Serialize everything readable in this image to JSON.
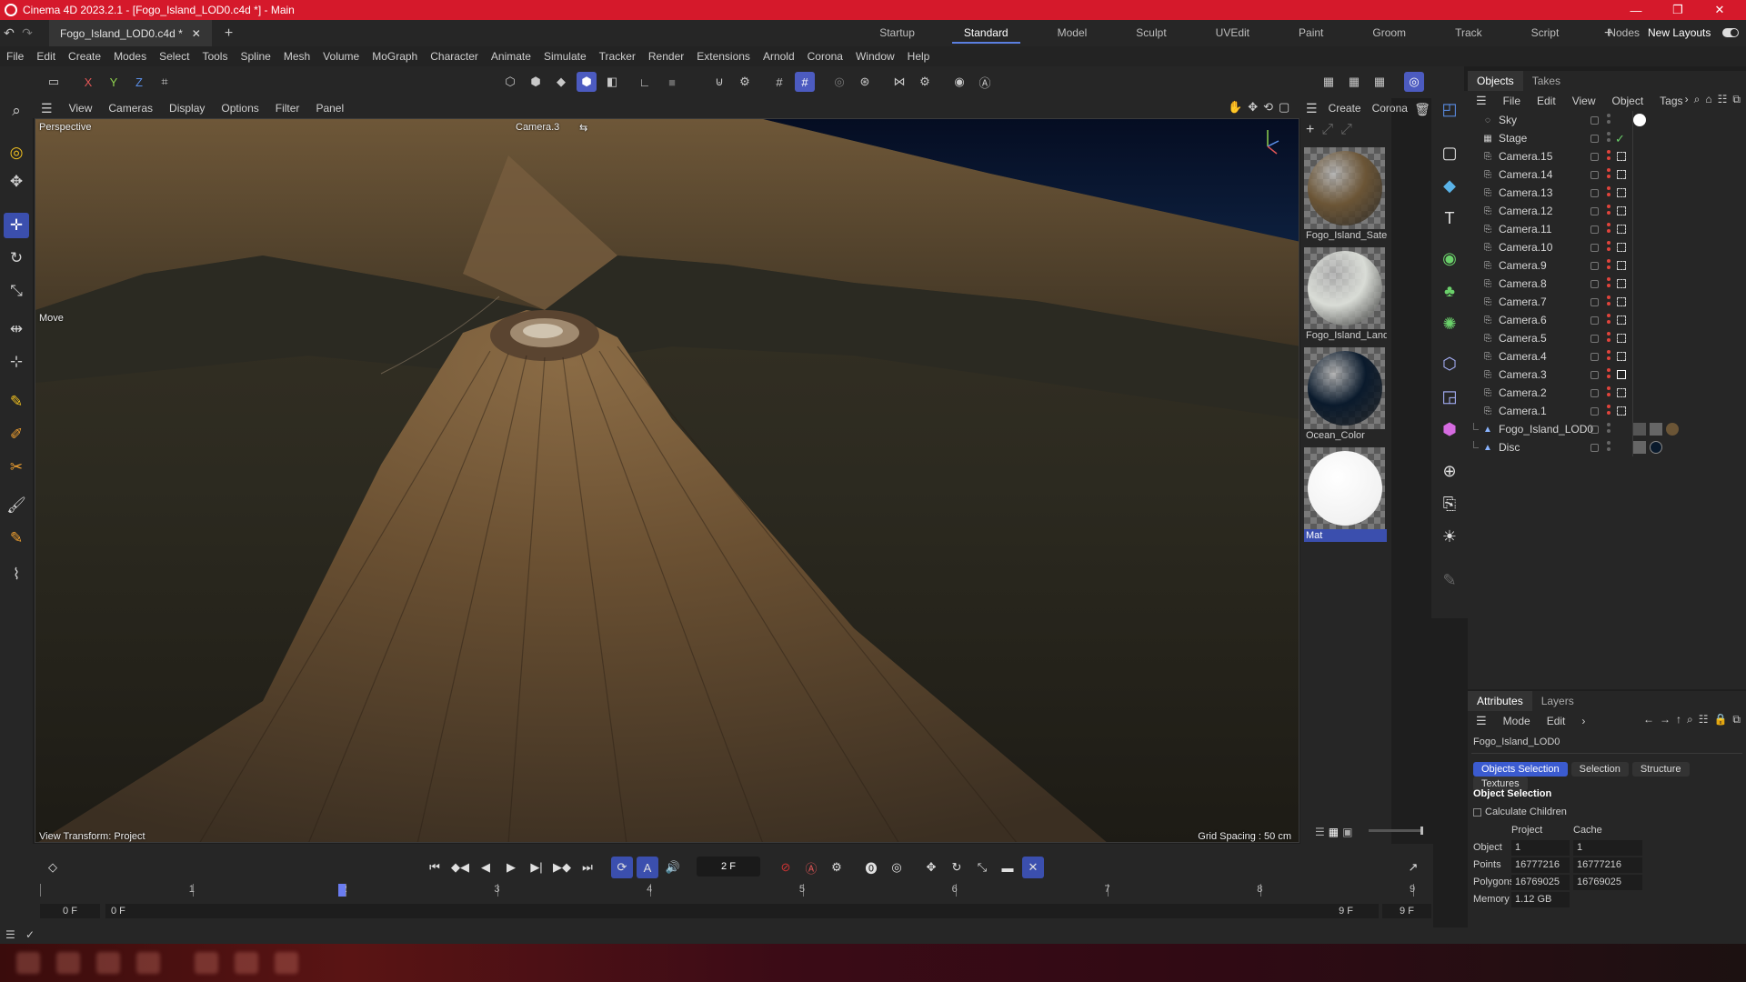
{
  "window": {
    "title": "Cinema 4D 2023.2.1 - [Fogo_Island_LOD0.c4d *] - Main",
    "doc_tab": "Fogo_Island_LOD0.c4d *",
    "controls": [
      "—",
      "❐",
      "✕"
    ]
  },
  "layouts": [
    "Startup",
    "Standard",
    "Model",
    "Sculpt",
    "UVEdit",
    "Paint",
    "Groom",
    "Track",
    "Script",
    "Nodes"
  ],
  "layout_active": "Standard",
  "new_layouts": "New Layouts",
  "menu": [
    "File",
    "Edit",
    "Create",
    "Modes",
    "Select",
    "Tools",
    "Spline",
    "Mesh",
    "Volume",
    "MoGraph",
    "Character",
    "Animate",
    "Simulate",
    "Tracker",
    "Render",
    "Extensions",
    "Arnold",
    "Corona",
    "Window",
    "Help"
  ],
  "axes": {
    "x": "X",
    "y": "Y",
    "z": "Z"
  },
  "viewport": {
    "menu": [
      "View",
      "Cameras",
      "Display",
      "Options",
      "Filter",
      "Panel"
    ],
    "projection": "Perspective",
    "camera": "Camera.3",
    "tool": "Move",
    "transform": "View Transform: Project",
    "grid": "Grid Spacing : 50 cm"
  },
  "materials": {
    "menu": [
      "Create",
      "Corona"
    ],
    "items": [
      {
        "name": "Fogo_Island_Satel",
        "color": "#6b5536"
      },
      {
        "name": "Fogo_Island_Land",
        "color": "#d9dcd6"
      },
      {
        "name": "Ocean_Color",
        "color": "#0a1a2c"
      },
      {
        "name": "Mat",
        "color": "#ffffff"
      }
    ]
  },
  "objects": {
    "tabs": [
      "Objects",
      "Takes"
    ],
    "menu": [
      "File",
      "Edit",
      "View",
      "Object",
      "Tags"
    ],
    "items": [
      {
        "name": "Sky",
        "icon": "sky-icon"
      },
      {
        "name": "Stage",
        "icon": "stage-icon"
      },
      {
        "name": "Camera.15",
        "icon": "camera-icon"
      },
      {
        "name": "Camera.14",
        "icon": "camera-icon"
      },
      {
        "name": "Camera.13",
        "icon": "camera-icon"
      },
      {
        "name": "Camera.12",
        "icon": "camera-icon"
      },
      {
        "name": "Camera.11",
        "icon": "camera-icon"
      },
      {
        "name": "Camera.10",
        "icon": "camera-icon"
      },
      {
        "name": "Camera.9",
        "icon": "camera-icon"
      },
      {
        "name": "Camera.8",
        "icon": "camera-icon"
      },
      {
        "name": "Camera.7",
        "icon": "camera-icon"
      },
      {
        "name": "Camera.6",
        "icon": "camera-icon"
      },
      {
        "name": "Camera.5",
        "icon": "camera-icon"
      },
      {
        "name": "Camera.4",
        "icon": "camera-icon"
      },
      {
        "name": "Camera.3",
        "icon": "camera-icon"
      },
      {
        "name": "Camera.2",
        "icon": "camera-icon"
      },
      {
        "name": "Camera.1",
        "icon": "camera-icon"
      },
      {
        "name": "Fogo_Island_LOD0",
        "icon": "polygon-object-icon"
      },
      {
        "name": "Disc",
        "icon": "polygon-object-icon"
      }
    ]
  },
  "attributes": {
    "tabs": [
      "Attributes",
      "Layers"
    ],
    "menu": [
      "Mode",
      "Edit"
    ],
    "object_name": "Fogo_Island_LOD0",
    "subtabs": [
      "Objects Selection",
      "Selection",
      "Structure",
      "Textures"
    ],
    "section": "Object Selection",
    "calculate_children": "Calculate Children",
    "col_project": "Project",
    "col_cache": "Cache",
    "rows": [
      {
        "label": "Object",
        "project": "1",
        "cache": "1"
      },
      {
        "label": "Points",
        "project": "16777216",
        "cache": "16777216"
      },
      {
        "label": "Polygons",
        "project": "16769025",
        "cache": "16769025"
      },
      {
        "label": "Memory",
        "project": "1.12 GB",
        "cache": ""
      }
    ]
  },
  "timeline": {
    "current_frame": "2 F",
    "ruler": [
      "0",
      "1",
      "2",
      "3",
      "4",
      "5",
      "6",
      "7",
      "8",
      "9"
    ],
    "current_index": 2,
    "start": "0 F",
    "range_start": "0 F",
    "range_end": "9 F",
    "end": "9 F"
  },
  "colors": {
    "accent": "#4c5bc0",
    "title_bar": "#d5192b",
    "render_dot": "#e0443c"
  }
}
